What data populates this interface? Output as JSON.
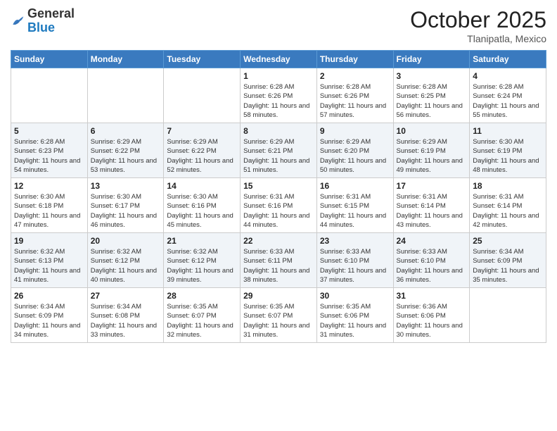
{
  "header": {
    "logo_general": "General",
    "logo_blue": "Blue",
    "month": "October 2025",
    "location": "Tlanipatla, Mexico"
  },
  "weekdays": [
    "Sunday",
    "Monday",
    "Tuesday",
    "Wednesday",
    "Thursday",
    "Friday",
    "Saturday"
  ],
  "weeks": [
    [
      {
        "day": "",
        "content": ""
      },
      {
        "day": "",
        "content": ""
      },
      {
        "day": "",
        "content": ""
      },
      {
        "day": "1",
        "sunrise": "6:28 AM",
        "sunset": "6:26 PM",
        "daylight": "11 hours and 58 minutes."
      },
      {
        "day": "2",
        "sunrise": "6:28 AM",
        "sunset": "6:26 PM",
        "daylight": "11 hours and 57 minutes."
      },
      {
        "day": "3",
        "sunrise": "6:28 AM",
        "sunset": "6:25 PM",
        "daylight": "11 hours and 56 minutes."
      },
      {
        "day": "4",
        "sunrise": "6:28 AM",
        "sunset": "6:24 PM",
        "daylight": "11 hours and 55 minutes."
      }
    ],
    [
      {
        "day": "5",
        "sunrise": "6:28 AM",
        "sunset": "6:23 PM",
        "daylight": "11 hours and 54 minutes."
      },
      {
        "day": "6",
        "sunrise": "6:29 AM",
        "sunset": "6:22 PM",
        "daylight": "11 hours and 53 minutes."
      },
      {
        "day": "7",
        "sunrise": "6:29 AM",
        "sunset": "6:22 PM",
        "daylight": "11 hours and 52 minutes."
      },
      {
        "day": "8",
        "sunrise": "6:29 AM",
        "sunset": "6:21 PM",
        "daylight": "11 hours and 51 minutes."
      },
      {
        "day": "9",
        "sunrise": "6:29 AM",
        "sunset": "6:20 PM",
        "daylight": "11 hours and 50 minutes."
      },
      {
        "day": "10",
        "sunrise": "6:29 AM",
        "sunset": "6:19 PM",
        "daylight": "11 hours and 49 minutes."
      },
      {
        "day": "11",
        "sunrise": "6:30 AM",
        "sunset": "6:19 PM",
        "daylight": "11 hours and 48 minutes."
      }
    ],
    [
      {
        "day": "12",
        "sunrise": "6:30 AM",
        "sunset": "6:18 PM",
        "daylight": "11 hours and 47 minutes."
      },
      {
        "day": "13",
        "sunrise": "6:30 AM",
        "sunset": "6:17 PM",
        "daylight": "11 hours and 46 minutes."
      },
      {
        "day": "14",
        "sunrise": "6:30 AM",
        "sunset": "6:16 PM",
        "daylight": "11 hours and 45 minutes."
      },
      {
        "day": "15",
        "sunrise": "6:31 AM",
        "sunset": "6:16 PM",
        "daylight": "11 hours and 44 minutes."
      },
      {
        "day": "16",
        "sunrise": "6:31 AM",
        "sunset": "6:15 PM",
        "daylight": "11 hours and 44 minutes."
      },
      {
        "day": "17",
        "sunrise": "6:31 AM",
        "sunset": "6:14 PM",
        "daylight": "11 hours and 43 minutes."
      },
      {
        "day": "18",
        "sunrise": "6:31 AM",
        "sunset": "6:14 PM",
        "daylight": "11 hours and 42 minutes."
      }
    ],
    [
      {
        "day": "19",
        "sunrise": "6:32 AM",
        "sunset": "6:13 PM",
        "daylight": "11 hours and 41 minutes."
      },
      {
        "day": "20",
        "sunrise": "6:32 AM",
        "sunset": "6:12 PM",
        "daylight": "11 hours and 40 minutes."
      },
      {
        "day": "21",
        "sunrise": "6:32 AM",
        "sunset": "6:12 PM",
        "daylight": "11 hours and 39 minutes."
      },
      {
        "day": "22",
        "sunrise": "6:33 AM",
        "sunset": "6:11 PM",
        "daylight": "11 hours and 38 minutes."
      },
      {
        "day": "23",
        "sunrise": "6:33 AM",
        "sunset": "6:10 PM",
        "daylight": "11 hours and 37 minutes."
      },
      {
        "day": "24",
        "sunrise": "6:33 AM",
        "sunset": "6:10 PM",
        "daylight": "11 hours and 36 minutes."
      },
      {
        "day": "25",
        "sunrise": "6:34 AM",
        "sunset": "6:09 PM",
        "daylight": "11 hours and 35 minutes."
      }
    ],
    [
      {
        "day": "26",
        "sunrise": "6:34 AM",
        "sunset": "6:09 PM",
        "daylight": "11 hours and 34 minutes."
      },
      {
        "day": "27",
        "sunrise": "6:34 AM",
        "sunset": "6:08 PM",
        "daylight": "11 hours and 33 minutes."
      },
      {
        "day": "28",
        "sunrise": "6:35 AM",
        "sunset": "6:07 PM",
        "daylight": "11 hours and 32 minutes."
      },
      {
        "day": "29",
        "sunrise": "6:35 AM",
        "sunset": "6:07 PM",
        "daylight": "11 hours and 31 minutes."
      },
      {
        "day": "30",
        "sunrise": "6:35 AM",
        "sunset": "6:06 PM",
        "daylight": "11 hours and 31 minutes."
      },
      {
        "day": "31",
        "sunrise": "6:36 AM",
        "sunset": "6:06 PM",
        "daylight": "11 hours and 30 minutes."
      },
      {
        "day": "",
        "content": ""
      }
    ]
  ],
  "labels": {
    "sunrise": "Sunrise:",
    "sunset": "Sunset:",
    "daylight": "Daylight:"
  }
}
